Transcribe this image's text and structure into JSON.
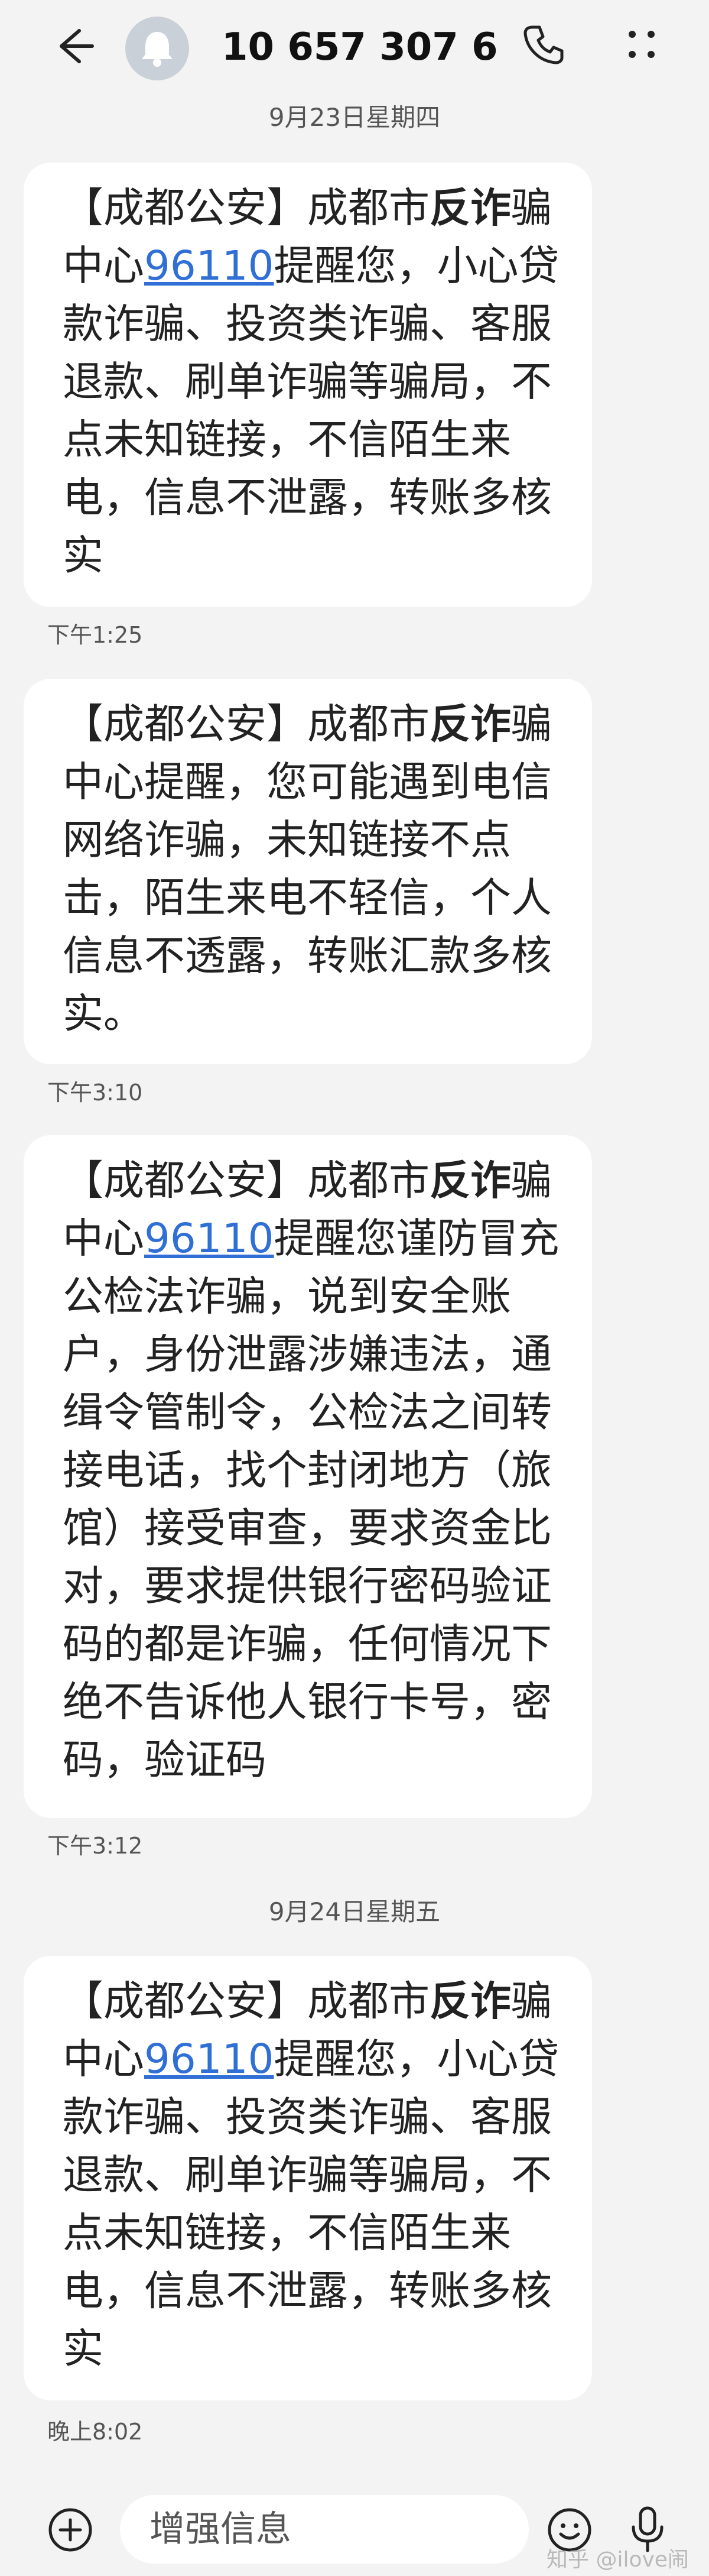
{
  "header": {
    "title": "10 657 307 6..."
  },
  "dates": [
    "9月23日星期四",
    "9月24日星期五"
  ],
  "messages": [
    {
      "prefix": "【成都公安】成都市",
      "bold": "反诈",
      "mid": "骗中心",
      "link": "96110",
      "rest": "提醒您，小心贷款诈骗、投资类诈骗、客服退款、刷单诈骗等骗局，不点未知链接，不信陌生来电，信息不泄露，转账多核实",
      "time": "下午1:25"
    },
    {
      "prefix": "【成都公安】成都市",
      "bold": "反诈",
      "mid": "骗中心提醒，您可能遇到电信网络诈骗，未知链接不点击，陌生来电不轻信，个人信息不透露，转账汇款多核实。",
      "link": "",
      "rest": "",
      "time": "下午3:10"
    },
    {
      "prefix": "【成都公安】成都市",
      "bold": "反诈",
      "mid": "骗中心",
      "link": "96110",
      "rest": "提醒您谨防冒充公检法诈骗，说到安全账户，身份泄露涉嫌违法，通缉令管制令，公检法之间转接电话，找个封闭地方（旅馆）接受审查，要求资金比对，要求提供银行密码验证码的都是诈骗，任何情况下绝不告诉他人银行卡号，密码，验证码",
      "time": "下午3:12"
    },
    {
      "prefix": "【成都公安】成都市",
      "bold": "反诈",
      "mid": "骗中心",
      "link": "96110",
      "rest": "提醒您，小心贷款诈骗、投资类诈骗、客服退款、刷单诈骗等骗局，不点未知链接，不信陌生来电，信息不泄露，转账多核实",
      "time": "晚上8:02"
    }
  ],
  "input": {
    "placeholder": "增强信息"
  },
  "watermark": "知乎 @ilove闹闹",
  "icons": {
    "back": "back-arrow-icon",
    "avatar": "bell-avatar-icon",
    "call": "phone-icon",
    "more": "more-icon",
    "plus": "plus-circle-icon",
    "emoji": "emoji-icon",
    "mic": "microphone-icon"
  },
  "colors": {
    "background": "#f3f3f3",
    "bubble": "#ffffff",
    "link": "#2f6fd6"
  }
}
